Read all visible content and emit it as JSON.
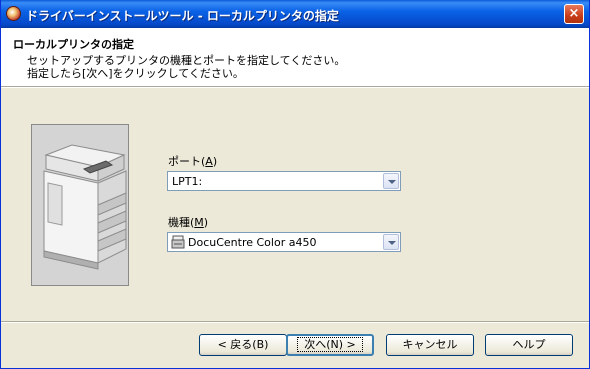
{
  "window": {
    "title": "ドライバーインストールツール - ローカルプリンタの指定",
    "close_label": "×"
  },
  "header": {
    "title": "ローカルプリンタの指定",
    "line1": "セットアップするプリンタの機種とポートを指定してください。",
    "line2": "指定したら[次へ]をクリックしてください。"
  },
  "form": {
    "port": {
      "label": "ポート(",
      "accel": "A",
      "label_end": ")",
      "value": "LPT1:"
    },
    "model": {
      "label": "機種(",
      "accel": "M",
      "label_end": ")",
      "value": "DocuCentre Color a450"
    }
  },
  "buttons": {
    "back": "< 戻る(B)",
    "next": "次へ(N) >",
    "cancel": "キャンセル",
    "help": "ヘルプ"
  }
}
